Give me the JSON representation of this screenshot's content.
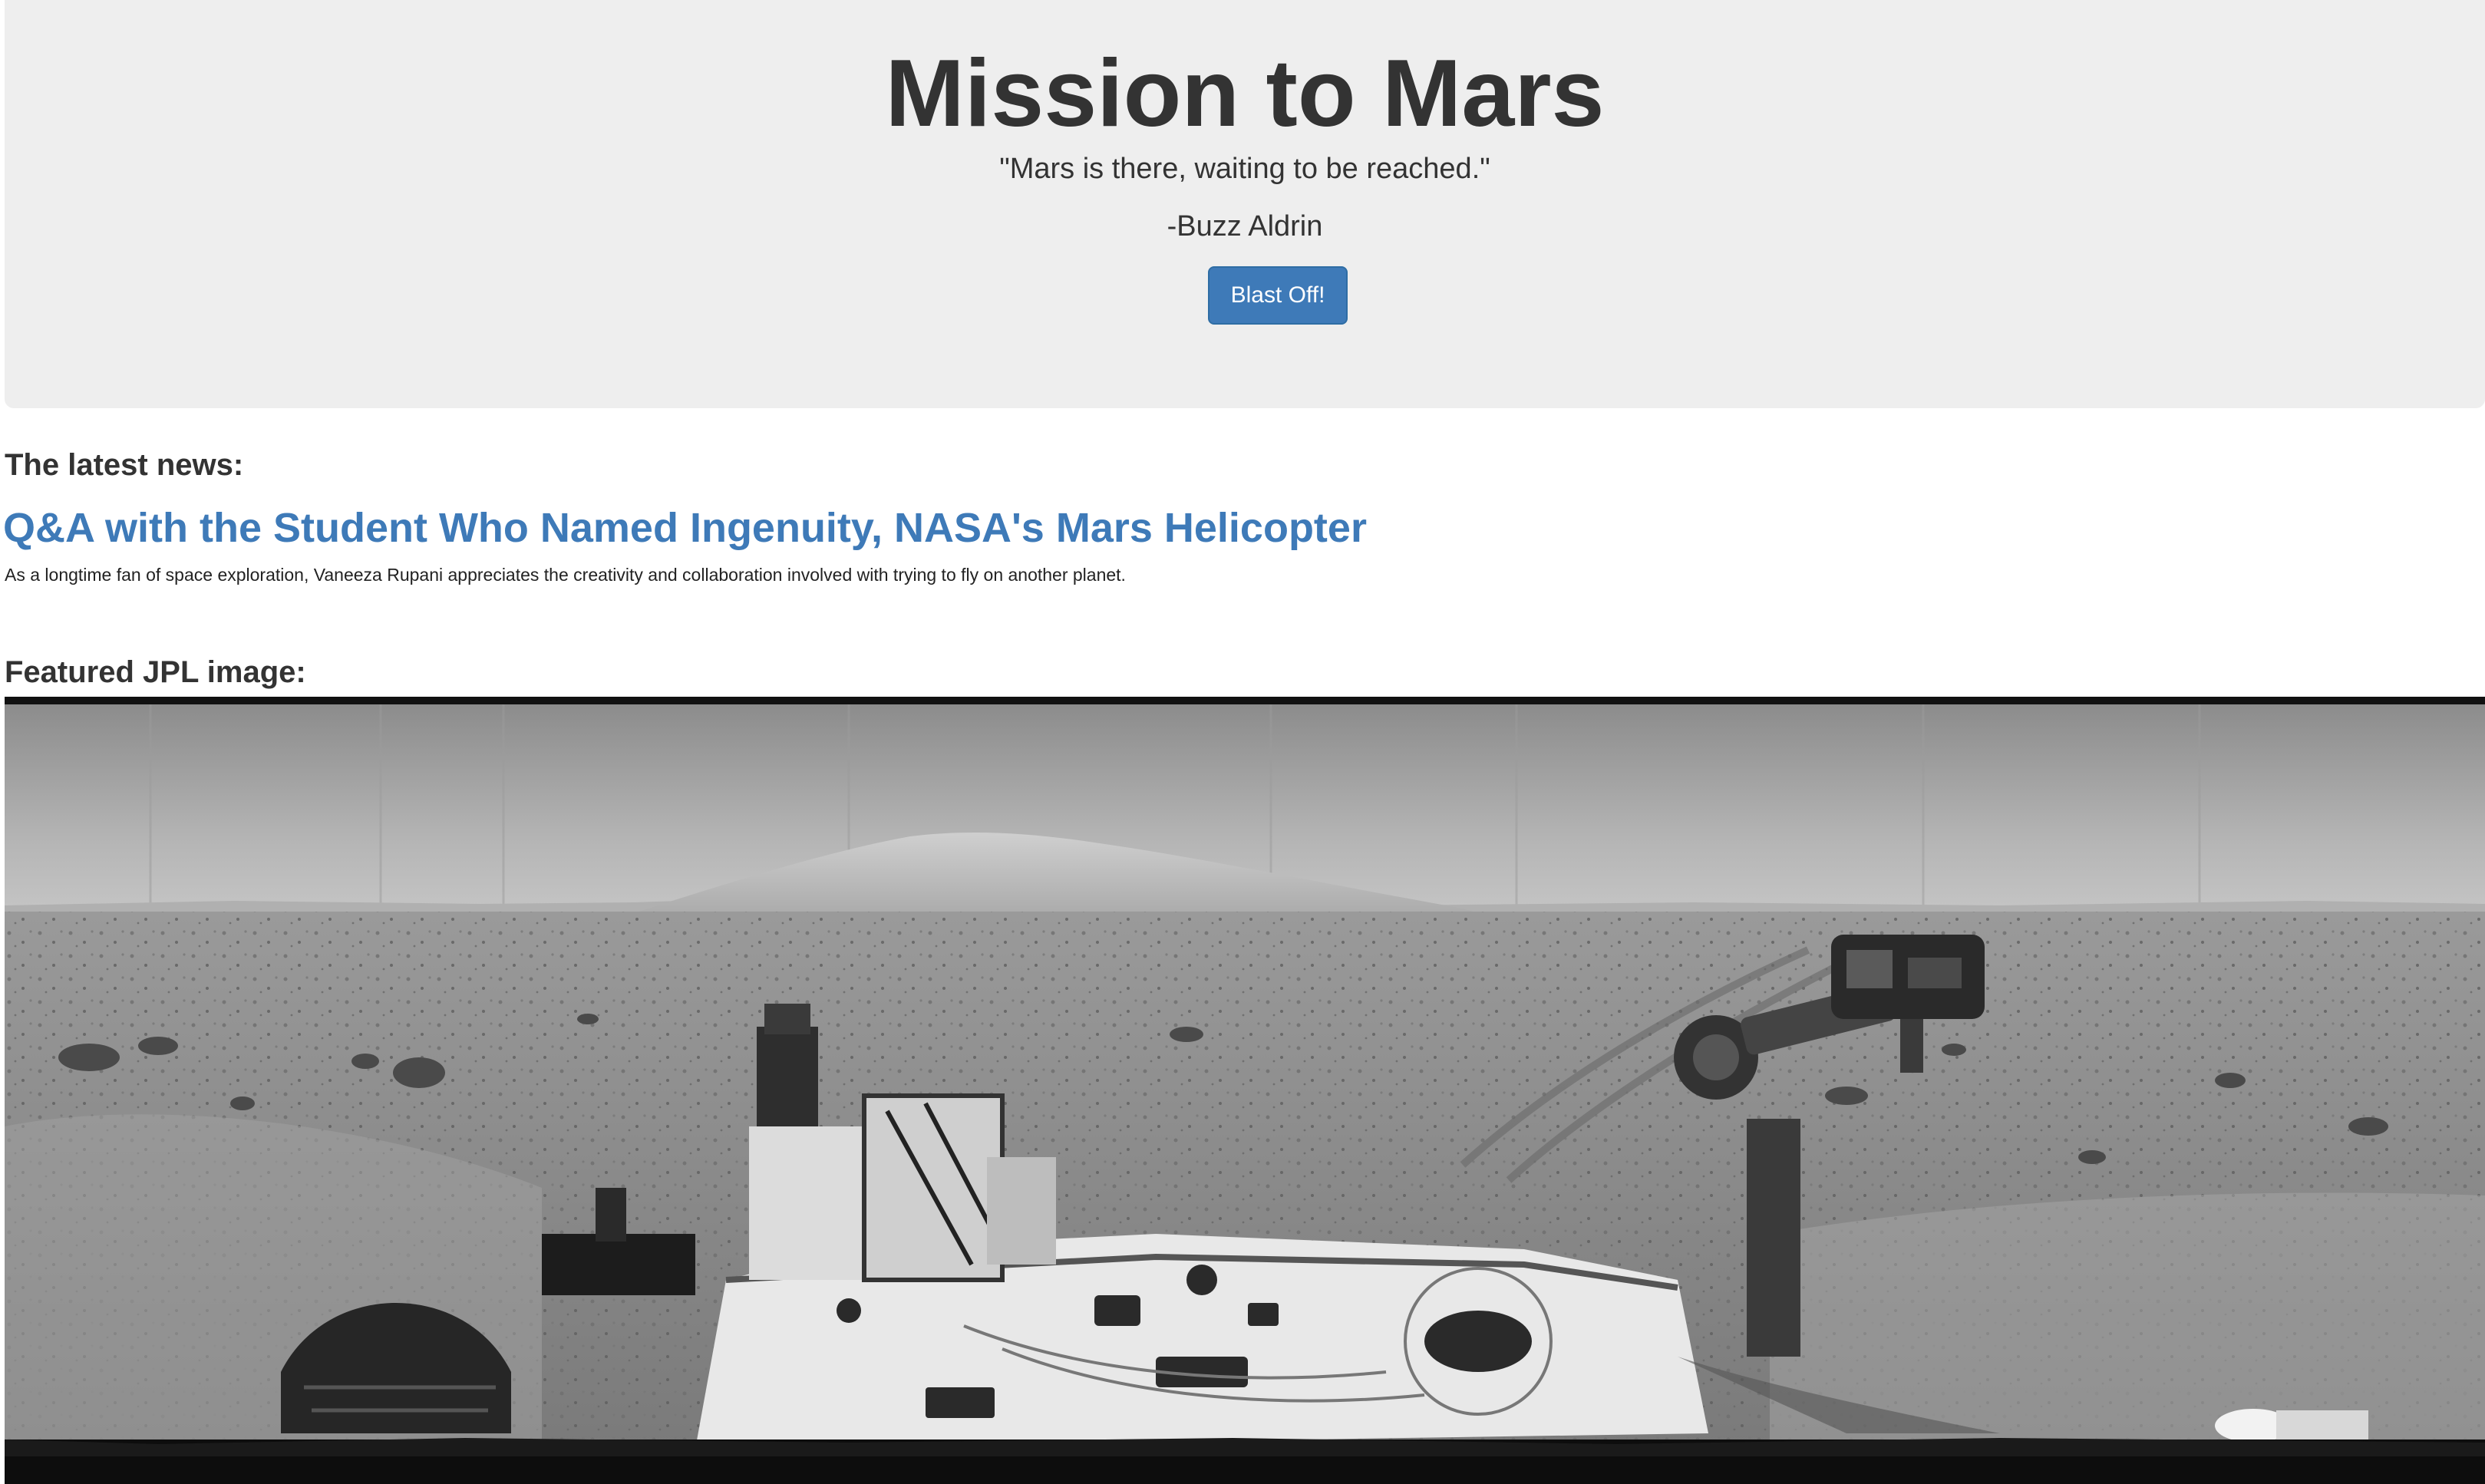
{
  "header": {
    "title": "Mission to Mars",
    "quote": "\"Mars is there, waiting to be reached.\"",
    "author": "-Buzz Aldrin",
    "button_label": "Blast Off!"
  },
  "news": {
    "heading": "The latest news:",
    "title": "Q&A with the Student Who Named Ingenuity, NASA's Mars Helicopter",
    "teaser": "As a longtime fan of space exploration, Vaneeza Rupani appreciates the creativity and collaboration involved with trying to fly on another planet."
  },
  "featured_image": {
    "heading": "Featured JPL image:",
    "subject": "panoramic grayscale view of a Mars rover deck with a distant mountain on the horizon"
  },
  "colors": {
    "jumbotron_bg": "#eeeeee",
    "button_bg": "#3e7ab8",
    "link": "#3e7ab8",
    "text": "#333333"
  }
}
